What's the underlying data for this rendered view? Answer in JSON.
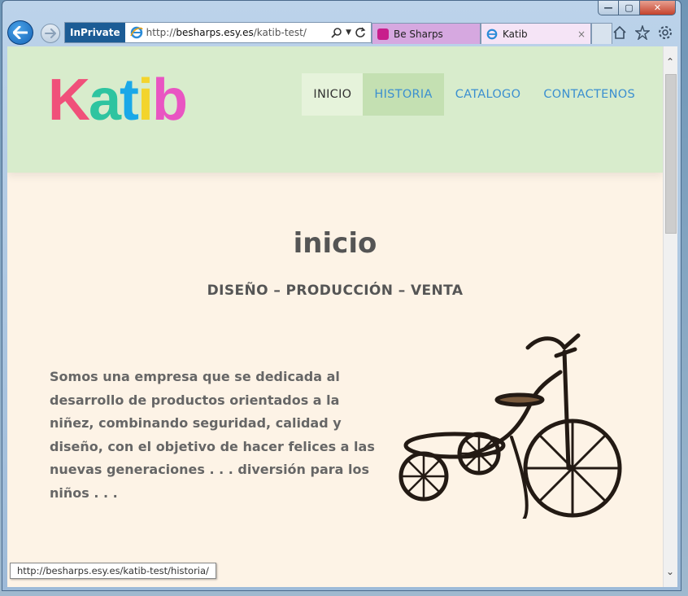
{
  "browser": {
    "caption_buttons": {
      "minimize": "—",
      "maximize": "▢",
      "close": "✕"
    },
    "inprivate_label": "InPrivate",
    "address": {
      "prefix": "http://",
      "host": "besharps.esy.es",
      "path": "/katib-test/"
    },
    "tabs": [
      {
        "title": "Be Sharps",
        "favicon_color": "#c81e8c"
      },
      {
        "title": "Katib",
        "close": "×"
      }
    ],
    "status_url": "http://besharps.esy.es/katib-test/historia/"
  },
  "site": {
    "logo": {
      "k": "K",
      "a": "a",
      "t": "t",
      "i": "i",
      "b": "b"
    },
    "nav": [
      "INICIO",
      "HISTORIA",
      "CATALOGO",
      "CONTACTENOS"
    ],
    "page_title": "inicio",
    "tagline": "DISEÑO  –  PRODUCCIÓN  –  VENTA",
    "intro": "Somos una empresa que se dedicada al desarrollo de productos orientados a la niñez, combinando seguridad, calidad y diseño, con el objetivo de hacer felices a las nuevas generaciones . . .   diversión para los niños . . ."
  },
  "colors": {
    "header_bg": "#d8eccc",
    "page_bg": "#fdf3e6",
    "nav_link": "#3b8fd0"
  },
  "icons": [
    "back-arrow-icon",
    "forward-arrow-icon",
    "search-icon",
    "refresh-icon",
    "home-icon",
    "star-icon",
    "gear-icon",
    "tricycle-image"
  ]
}
